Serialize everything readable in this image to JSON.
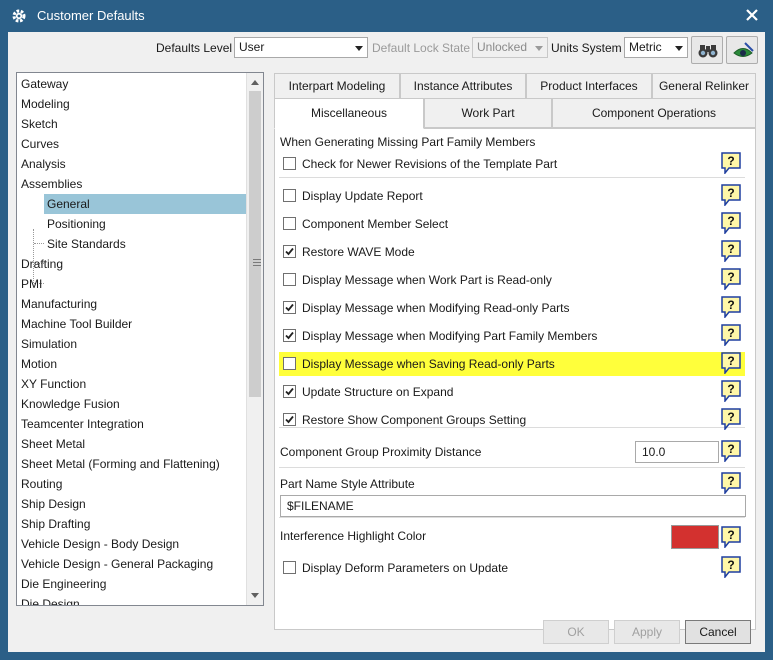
{
  "window": {
    "title": "Customer Defaults"
  },
  "header": {
    "defaults_level_label": "Defaults Level",
    "defaults_level_value": "User",
    "default_lock_state_label": "Default Lock State",
    "default_lock_state_value": "Unlocked",
    "units_system_label": "Units System",
    "units_system_value": "Metric"
  },
  "tree": {
    "items": [
      {
        "label": "Gateway"
      },
      {
        "label": "Modeling"
      },
      {
        "label": "Sketch"
      },
      {
        "label": "Curves"
      },
      {
        "label": "Analysis"
      },
      {
        "label": "Assemblies"
      },
      {
        "label": "General"
      },
      {
        "label": "Positioning"
      },
      {
        "label": "Site Standards"
      },
      {
        "label": "Drafting"
      },
      {
        "label": "PMI"
      },
      {
        "label": "Manufacturing"
      },
      {
        "label": "Machine Tool Builder"
      },
      {
        "label": "Simulation"
      },
      {
        "label": "Motion"
      },
      {
        "label": "XY Function"
      },
      {
        "label": "Knowledge Fusion"
      },
      {
        "label": "Teamcenter Integration"
      },
      {
        "label": "Sheet Metal"
      },
      {
        "label": "Sheet Metal (Forming and Flattening)"
      },
      {
        "label": "Routing"
      },
      {
        "label": "Ship Design"
      },
      {
        "label": "Ship Drafting"
      },
      {
        "label": "Vehicle Design - Body Design"
      },
      {
        "label": "Vehicle Design - General Packaging"
      },
      {
        "label": "Die Engineering"
      },
      {
        "label": "Die Design"
      }
    ],
    "selected": "General"
  },
  "tabs": {
    "row1": [
      "Interpart Modeling",
      "Instance Attributes",
      "Product Interfaces",
      "General Relinker"
    ],
    "row2": [
      "Miscellaneous",
      "Work Part",
      "Component Operations"
    ],
    "active": "Miscellaneous"
  },
  "panel": {
    "group_heading": "When Generating Missing Part Family Members",
    "options": [
      {
        "label": "Check for Newer Revisions of the Template Part",
        "checked": false
      },
      {
        "label": "Display Update Report",
        "checked": false
      },
      {
        "label": "Component Member Select",
        "checked": false
      },
      {
        "label": "Restore WAVE Mode",
        "checked": true
      },
      {
        "label": "Display Message when Work Part is Read-only",
        "checked": false
      },
      {
        "label": "Display Message when Modifying Read-only Parts",
        "checked": true
      },
      {
        "label": "Display Message when Modifying Part Family Members",
        "checked": true
      },
      {
        "label": "Display Message when Saving Read-only Parts",
        "checked": false,
        "highlighted": true
      },
      {
        "label": "Update Structure on Expand",
        "checked": true
      },
      {
        "label": "Restore Show Component Groups Setting",
        "checked": true
      }
    ],
    "proximity_label": "Component Group Proximity Distance",
    "proximity_value": "10.0",
    "part_name_label": "Part Name Style Attribute",
    "part_name_value": "$FILENAME",
    "interference_label": "Interference Highlight Color",
    "interference_color": "#d3312f",
    "deform_label": "Display Deform Parameters on Update",
    "deform_checked": false
  },
  "footer": {
    "ok": "OK",
    "apply": "Apply",
    "cancel": "Cancel"
  },
  "colors": {
    "titlebar": "#2b5f87",
    "selection": "#99c5d8",
    "highlight": "#ffff3b"
  }
}
